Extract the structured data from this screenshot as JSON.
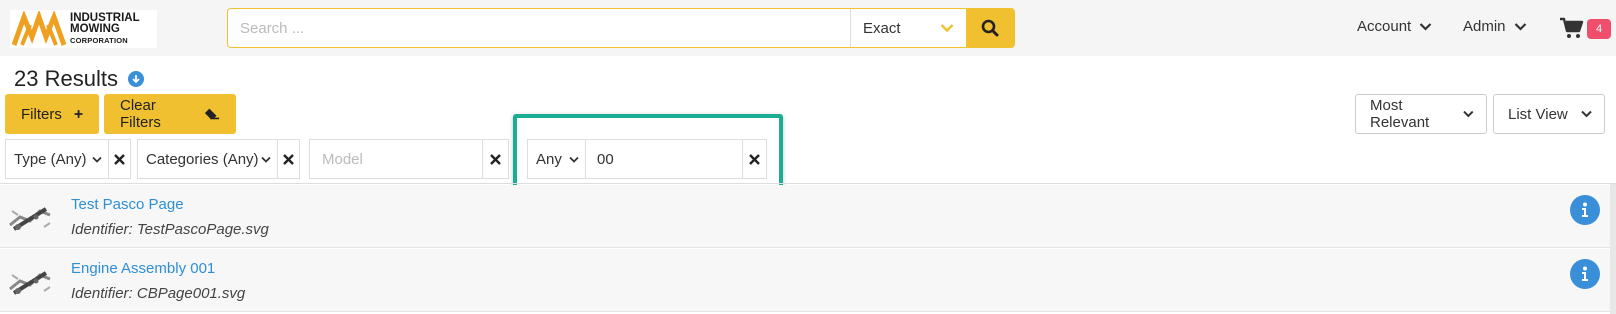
{
  "header": {
    "logo": {
      "line1": "INDUSTRIAL",
      "line2": "MOWING",
      "line3": "CORPORATION"
    },
    "search": {
      "placeholder": "Search ...",
      "value": "",
      "mode": "Exact"
    },
    "nav": {
      "account": "Account",
      "admin": "Admin"
    },
    "cart": {
      "count": "4"
    }
  },
  "results": {
    "title": "23 Results"
  },
  "toolbar": {
    "filters_label": "Filters",
    "clear_filters_label": "Clear Filters",
    "sort_label": "Most Relevant",
    "view_label": "List View"
  },
  "filters": {
    "type": "Type (Any)",
    "categories": "Categories (Any)",
    "model_placeholder": "Model",
    "model_value": "",
    "match": "Any",
    "match_value": "00"
  },
  "items": [
    {
      "title": "Test Pasco Page",
      "identifier": "Identifier: TestPascoPage.svg"
    },
    {
      "title": "Engine Assembly 001",
      "identifier": "Identifier: CBPage001.svg"
    }
  ],
  "colors": {
    "accent": "#f0c030",
    "link": "#2f8fd6",
    "highlight": "#1cae95",
    "badge": "#ef4f6a",
    "info": "#3a8fd9"
  },
  "icons": [
    "logo-icon",
    "chevron-down-icon",
    "search-icon",
    "cart-icon",
    "arrow-down-circle-icon",
    "plus-icon",
    "eraser-icon",
    "close-icon",
    "info-icon"
  ]
}
